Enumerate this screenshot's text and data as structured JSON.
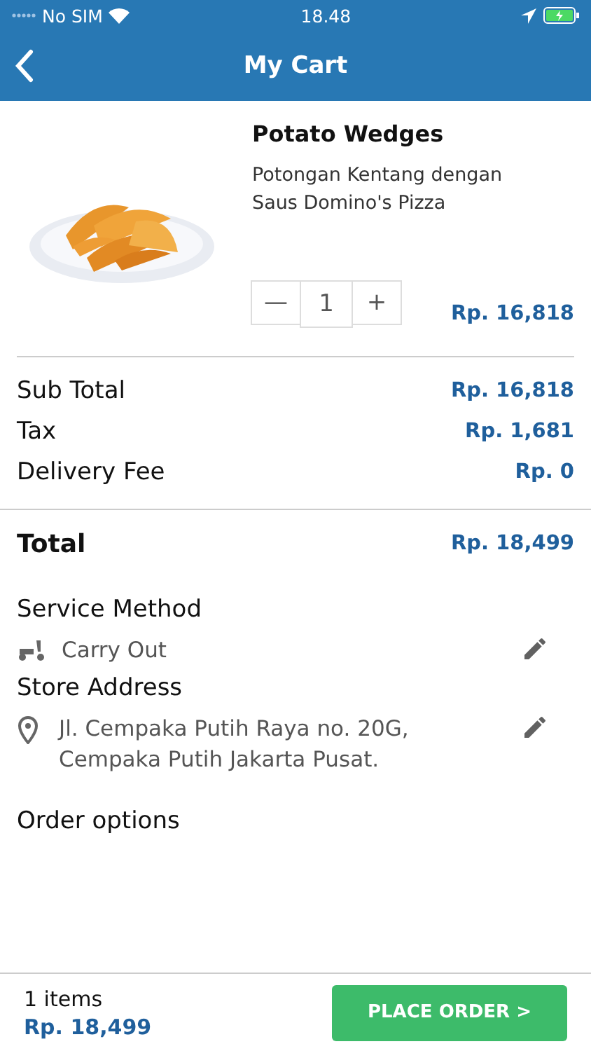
{
  "status_bar": {
    "carrier": "No SIM",
    "time": "18.48"
  },
  "header": {
    "title": "My Cart"
  },
  "items": [
    {
      "kind": "picture",
      "name": "Potato Wedges",
      "description": "Potongan Kentang dengan Saus Domino's Pizza",
      "minus": "—",
      "quantity": "1",
      "plus": "+",
      "price": "Rp. 16,818"
    }
  ],
  "summary": [
    {
      "label": "Sub Total",
      "value": "Rp. 16,818"
    },
    {
      "label": "Tax",
      "value": "Rp. 1,681"
    },
    {
      "label": "Delivery Fee",
      "value": "Rp. 0"
    }
  ],
  "total": {
    "label": "Total",
    "value": "Rp. 18,499"
  },
  "service_method": {
    "heading": "Service Method",
    "value": "Carry Out"
  },
  "store_address": {
    "heading": "Store Address",
    "value": "Jl. Cempaka Putih Raya no. 20G, Cempaka Putih Jakarta Pusat."
  },
  "order_options": {
    "heading": "Order options"
  },
  "footer": {
    "count": "1 items",
    "total": "Rp. 18,499",
    "button": "PLACE ORDER >"
  }
}
